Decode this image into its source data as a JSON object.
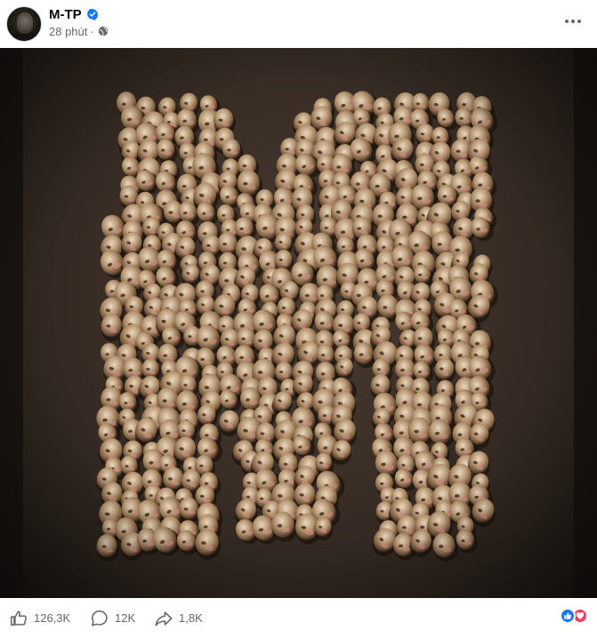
{
  "post": {
    "author": "M-TP",
    "verified": true,
    "timestamp": "28 phút",
    "separator": "·",
    "audience_icon": "globe-icon",
    "more_icon": "more-options-icon"
  },
  "media": {
    "letter": "M",
    "background_color": "#3a2e26"
  },
  "footer": {
    "likes": "126,3K",
    "comments": "12K",
    "shares": "1,8K",
    "reactions": [
      "like-reaction-icon",
      "love-reaction-icon"
    ]
  },
  "colors": {
    "verified_blue": "#1877f2",
    "love_red": "#f33e58",
    "secondary_text": "#65676b"
  }
}
